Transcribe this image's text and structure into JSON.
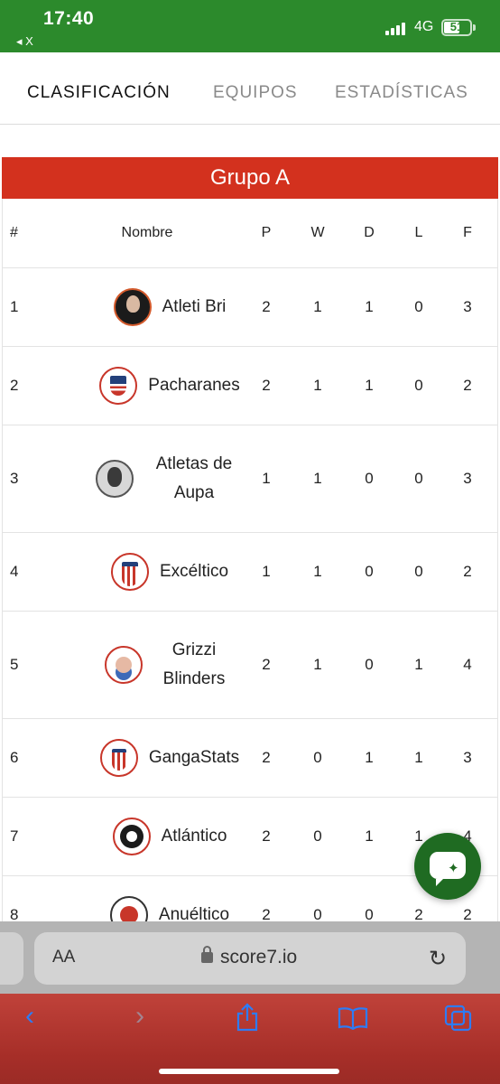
{
  "status": {
    "time": "17:40",
    "back_app": "◂ X",
    "network": "4G",
    "battery": "51"
  },
  "tabs": [
    {
      "label": "CLASIFICACIÓN",
      "active": true
    },
    {
      "label": "EQUIPOS",
      "active": false
    },
    {
      "label": "ESTADÍSTICAS",
      "active": false
    }
  ],
  "group_title": "Grupo A",
  "table": {
    "headers": [
      "#",
      "Nombre",
      "P",
      "W",
      "D",
      "L",
      "F"
    ],
    "rows": [
      {
        "pos": "1",
        "name": "Atleti Bri",
        "p": "2",
        "w": "1",
        "d": "1",
        "l": "0",
        "f": "3",
        "badge": "dark-portrait-badge"
      },
      {
        "pos": "2",
        "name": "Pacharanes",
        "p": "2",
        "w": "1",
        "d": "1",
        "l": "0",
        "f": "2",
        "badge": "shield-badge"
      },
      {
        "pos": "3",
        "name": "Atletas de Aupa",
        "p": "1",
        "w": "1",
        "d": "0",
        "l": "0",
        "f": "3",
        "badge": "photo-badge"
      },
      {
        "pos": "4",
        "name": "Excéltico",
        "p": "1",
        "w": "1",
        "d": "0",
        "l": "0",
        "f": "2",
        "badge": "striped-crest-badge"
      },
      {
        "pos": "5",
        "name": "Grizzi Blinders",
        "p": "2",
        "w": "1",
        "d": "0",
        "l": "1",
        "f": "4",
        "badge": "cartoon-badge"
      },
      {
        "pos": "6",
        "name": "GangaStats",
        "p": "2",
        "w": "0",
        "d": "1",
        "l": "1",
        "f": "3",
        "badge": "striped-crest-badge"
      },
      {
        "pos": "7",
        "name": "Atlántico",
        "p": "2",
        "w": "0",
        "d": "1",
        "l": "1",
        "f": "4",
        "badge": "round-crest-badge"
      },
      {
        "pos": "8",
        "name": "Anuéltico",
        "p": "2",
        "w": "0",
        "d": "0",
        "l": "2",
        "f": "2",
        "badge": "round-crest-badge"
      }
    ]
  },
  "browser": {
    "aa_label": "AA",
    "url": "score7.io"
  },
  "colors": {
    "status_bar": "#2c8a2c",
    "group_header": "#d3311e",
    "fab": "#1f6b22",
    "toolbar": "#a62e28",
    "toolbar_icons": "#2d7cf6"
  },
  "icons": [
    "chat-sparkle-icon",
    "back-icon",
    "forward-icon",
    "share-icon",
    "bookmarks-icon",
    "tabs-icon",
    "reload-icon",
    "lock-icon"
  ]
}
